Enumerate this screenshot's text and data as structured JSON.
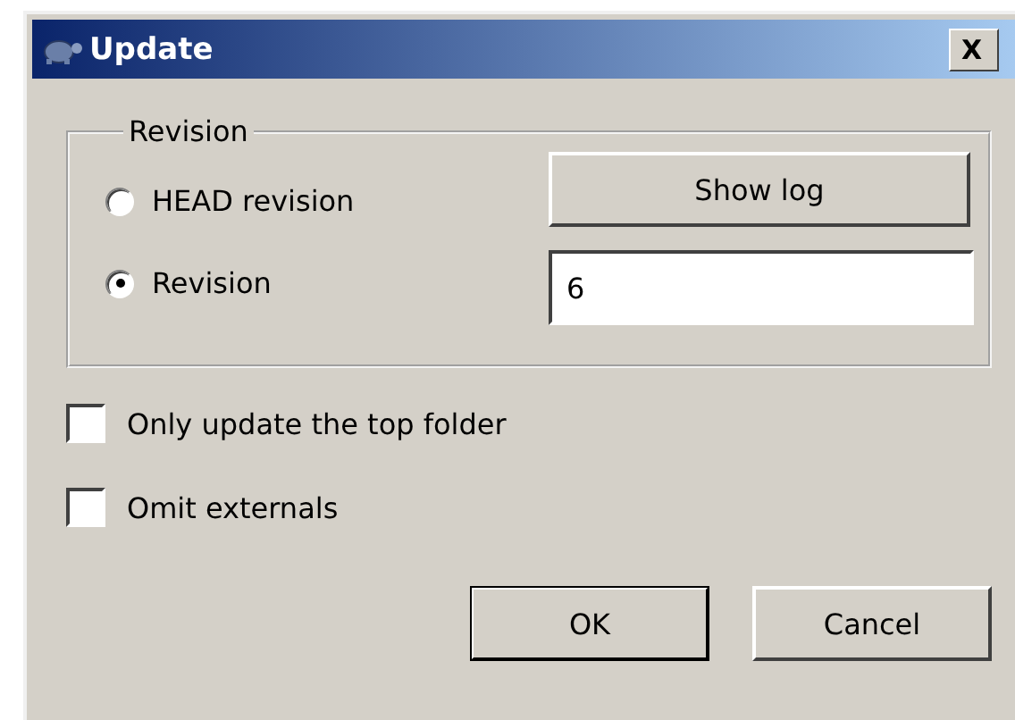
{
  "window": {
    "title": "Update",
    "close": "X"
  },
  "revision_group": {
    "legend": "Revision",
    "options": [
      {
        "label": "HEAD revision",
        "selected": false
      },
      {
        "label": "Revision",
        "selected": true
      }
    ],
    "show_log_button": "Show log",
    "revision_field": {
      "value": "6"
    }
  },
  "checkboxes": [
    {
      "label": "Only update the top folder",
      "checked": false
    },
    {
      "label": "Omit externals",
      "checked": false
    }
  ],
  "buttons": [
    {
      "label": "OK",
      "default": true
    },
    {
      "label": "Cancel",
      "default": false
    }
  ]
}
